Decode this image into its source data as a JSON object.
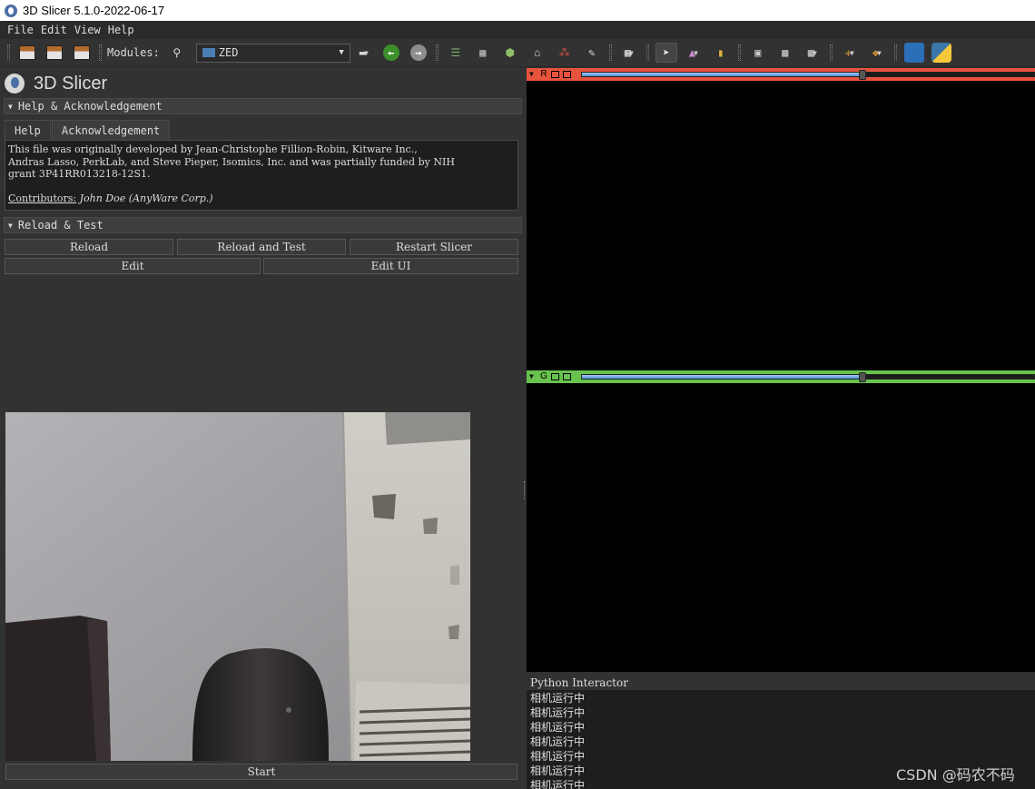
{
  "window": {
    "title": "3D Slicer 5.1.0-2022-06-17"
  },
  "menubar": {
    "items": [
      "File",
      "Edit",
      "View",
      "Help"
    ]
  },
  "toolbar": {
    "modules_label": "Modules:",
    "module_selected": "ZED",
    "icons": [
      "data-icon",
      "dcm-icon",
      "save-icon",
      "search-icon",
      "layout-icon",
      "back-arrow-icon",
      "forward-arrow-icon",
      "data-module-icon",
      "volumes-icon",
      "models-icon",
      "transforms-icon",
      "markups-icon",
      "editor-icon",
      "layout-grid-icon",
      "pointer-icon",
      "crosshair-icon",
      "fiducial-icon",
      "screen-capture-icon",
      "extensions-icon",
      "python-icon"
    ]
  },
  "panel": {
    "title": "3D Slicer",
    "help_section": "Help & Acknowledgement",
    "tabs": [
      "Help",
      "Acknowledgement"
    ],
    "ack_text_1": "This file was originally developed by Jean-Christophe Fillion-Robin, Kitware Inc.,",
    "ack_text_2": "Andras Lasso, PerkLab, and Steve Pieper, Isomics, Inc. and was partially funded by NIH",
    "ack_text_3": "grant 3P41RR013218-12S1.",
    "contributors_label": "Contributors:",
    "contributors_value": "John Doe (AnyWare Corp.)",
    "reload_section": "Reload & Test",
    "buttons": {
      "reload": "Reload",
      "reload_and_test": "Reload and Test",
      "restart": "Restart Slicer",
      "edit": "Edit",
      "edit_ui": "Edit UI",
      "start": "Start"
    }
  },
  "views": {
    "red": {
      "letter": "R",
      "color": "#e8533d",
      "slider_fraction": 0.62
    },
    "green": {
      "letter": "G",
      "color": "#67c24e",
      "slider_fraction": 0.62
    }
  },
  "python": {
    "title": "Python Interactor",
    "lines": [
      "相机运行中",
      "相机运行中",
      "相机运行中",
      "相机运行中",
      "相机运行中",
      "相机运行中",
      "相机运行中"
    ]
  },
  "watermark": "CSDN @码农不码"
}
